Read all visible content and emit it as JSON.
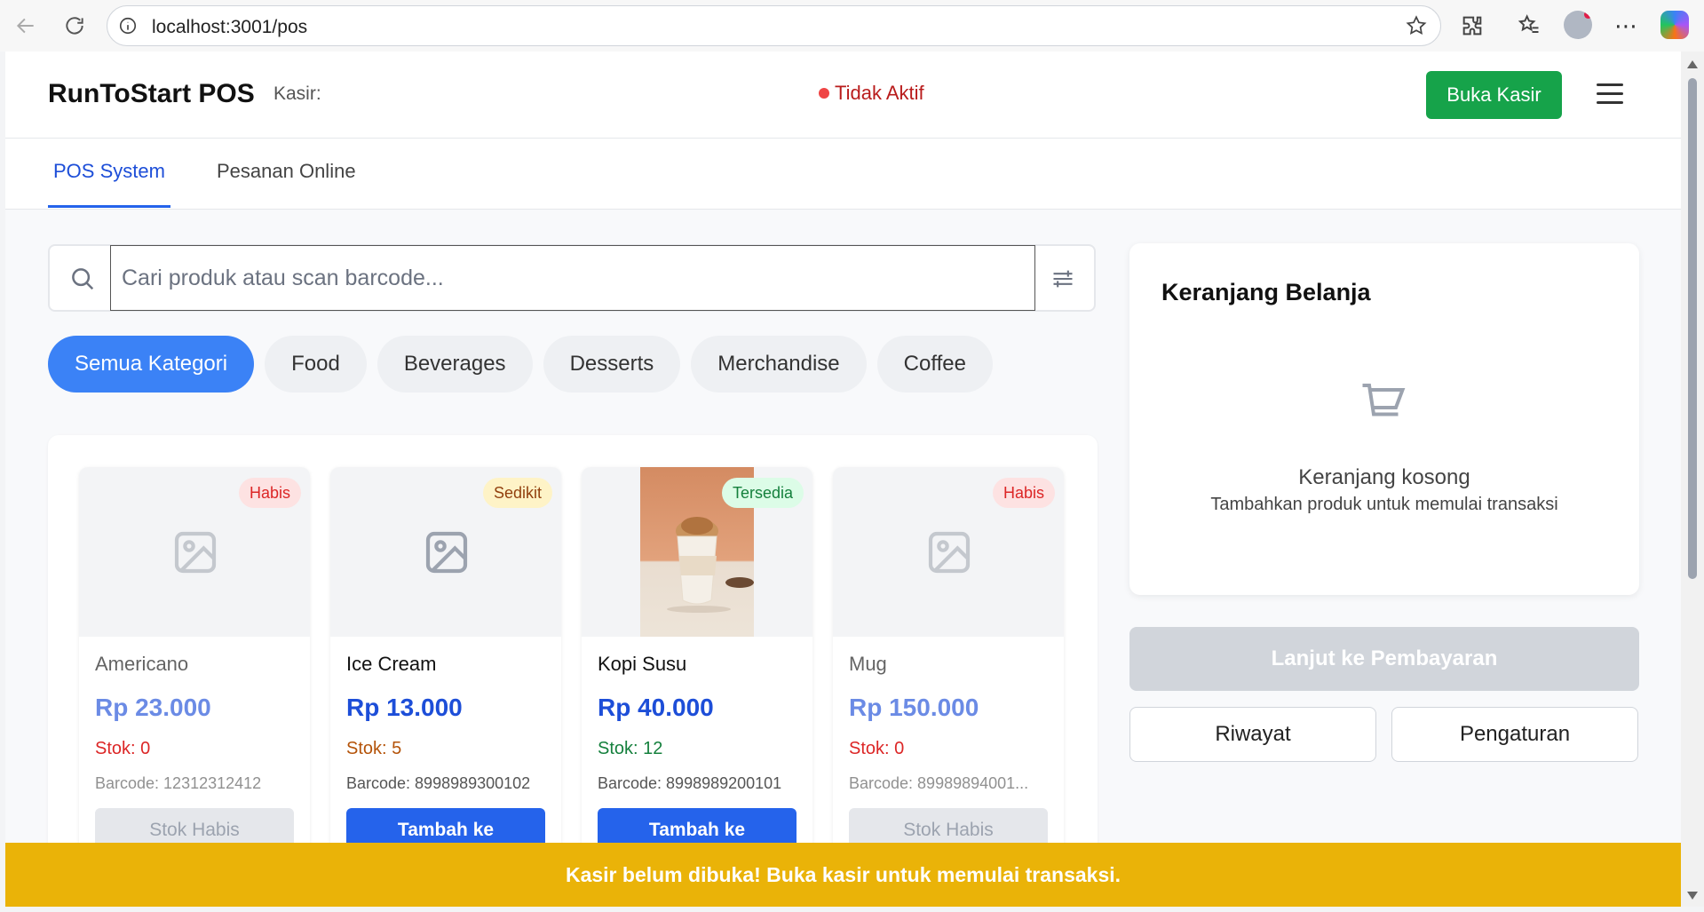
{
  "browser": {
    "url": "localhost:3001/pos"
  },
  "header": {
    "brand": "RunToStart POS",
    "kasir_label": "Kasir:",
    "status": "Tidak Aktif",
    "open_button": "Buka Kasir"
  },
  "tabs": [
    {
      "label": "POS System",
      "active": true
    },
    {
      "label": "Pesanan Online",
      "active": false
    }
  ],
  "search": {
    "placeholder": "Cari produk atau scan barcode..."
  },
  "categories": [
    {
      "label": "Semua Kategori",
      "active": true
    },
    {
      "label": "Food"
    },
    {
      "label": "Beverages"
    },
    {
      "label": "Desserts"
    },
    {
      "label": "Merchandise"
    },
    {
      "label": "Coffee"
    }
  ],
  "products": [
    {
      "name": "Americano",
      "price": "Rp 23.000",
      "stock": "Stok: 0",
      "barcode": "Barcode: 12312312412",
      "badge": "Habis",
      "button": "Stok Habis"
    },
    {
      "name": "Ice Cream",
      "price": "Rp 13.000",
      "stock": "Stok: 5",
      "barcode": "Barcode: 8998989300102",
      "badge": "Sedikit",
      "button": "Tambah ke"
    },
    {
      "name": "Kopi Susu",
      "price": "Rp 40.000",
      "stock": "Stok: 12",
      "barcode": "Barcode: 8998989200101",
      "badge": "Tersedia",
      "button": "Tambah ke"
    },
    {
      "name": "Mug",
      "price": "Rp 150.000",
      "stock": "Stok: 0",
      "barcode": "Barcode: 89989894001...",
      "badge": "Habis",
      "button": "Stok Habis"
    }
  ],
  "cart": {
    "title": "Keranjang Belanja",
    "empty_title": "Keranjang kosong",
    "empty_subtitle": "Tambahkan produk untuk memulai transaksi",
    "pay_button": "Lanjut ke Pembayaran",
    "history_button": "Riwayat",
    "settings_button": "Pengaturan"
  },
  "banner": "Kasir belum dibuka! Buka kasir untuk memulai transaksi.",
  "colors": {
    "primary": "#2563eb",
    "success": "#16a34a",
    "danger": "#dc2626",
    "warning_banner": "#eab308"
  }
}
